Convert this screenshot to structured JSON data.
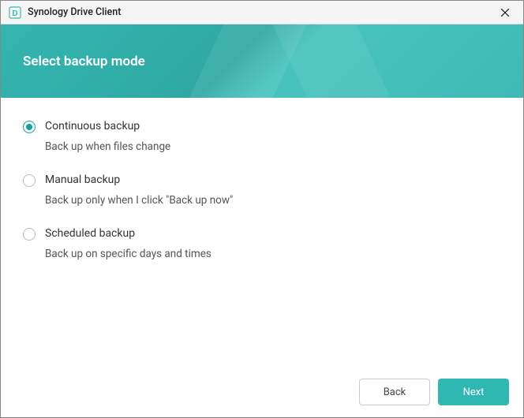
{
  "titlebar": {
    "app_title": "Synology Drive Client"
  },
  "header": {
    "title": "Select backup mode"
  },
  "options": [
    {
      "id": "continuous",
      "label": "Continuous backup",
      "description": "Back up when files change",
      "selected": true
    },
    {
      "id": "manual",
      "label": "Manual backup",
      "description": "Back up only when I click \"Back up now\"",
      "selected": false
    },
    {
      "id": "scheduled",
      "label": "Scheduled backup",
      "description": "Back up on specific days and times",
      "selected": false
    }
  ],
  "footer": {
    "back_label": "Back",
    "next_label": "Next"
  },
  "colors": {
    "accent": "#0aa5a0",
    "primary_button": "#2fb7b2"
  }
}
